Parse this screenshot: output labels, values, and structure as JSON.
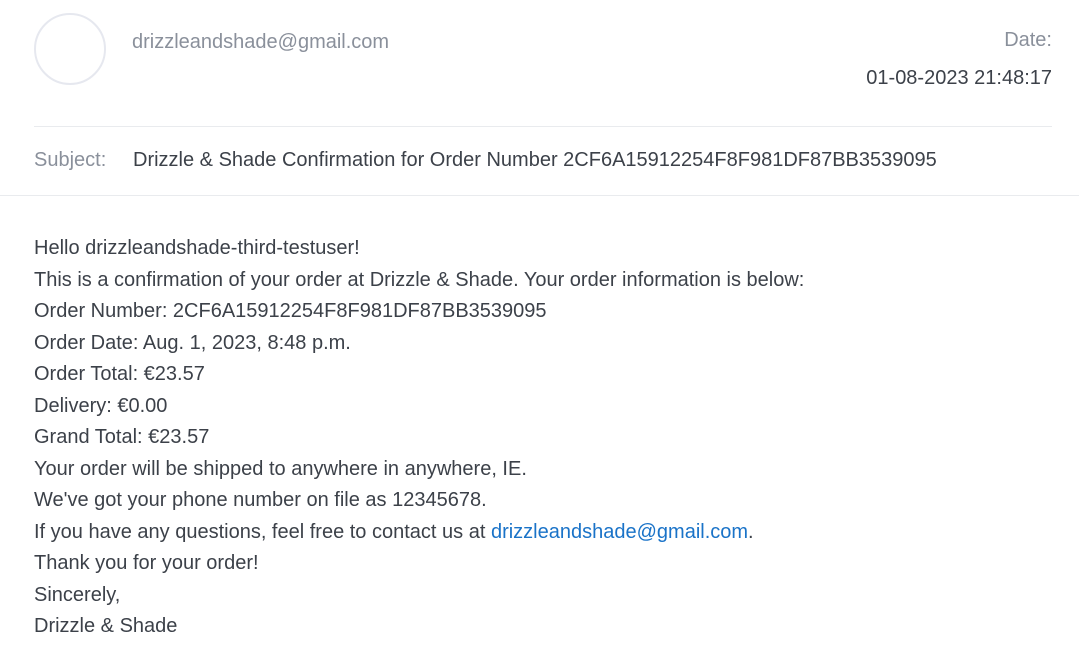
{
  "email": {
    "from": "drizzleandshade@gmail.com",
    "date_label": "Date:",
    "date_value": "01-08-2023 21:48:17",
    "subject_label": "Subject:",
    "subject_value": "Drizzle & Shade Confirmation for Order Number 2CF6A15912254F8F981DF87BB3539095"
  },
  "body": {
    "greeting": "Hello drizzleandshade-third-testuser!",
    "intro": "This is a confirmation of your order at Drizzle & Shade. Your order information is below:",
    "order_number": "Order Number: 2CF6A15912254F8F981DF87BB3539095",
    "order_date": "Order Date: Aug. 1, 2023, 8:48 p.m.",
    "order_total": "Order Total: €23.57",
    "delivery": "Delivery: €0.00",
    "grand_total": "Grand Total: €23.57",
    "shipping": "Your order will be shipped to anywhere in anywhere, IE.",
    "phone": "We've got your phone number on file as 12345678.",
    "questions_prefix": "If you have any questions, feel free to contact us at ",
    "contact_email": "drizzleandshade@gmail.com",
    "questions_suffix": ".",
    "thanks": "Thank you for your order!",
    "sincerely": "Sincerely,",
    "signature": "Drizzle & Shade"
  },
  "colors": {
    "muted_text": "#8a909b",
    "body_text": "#3c4149",
    "link": "#1a73c8",
    "divider": "#e9ebee"
  }
}
